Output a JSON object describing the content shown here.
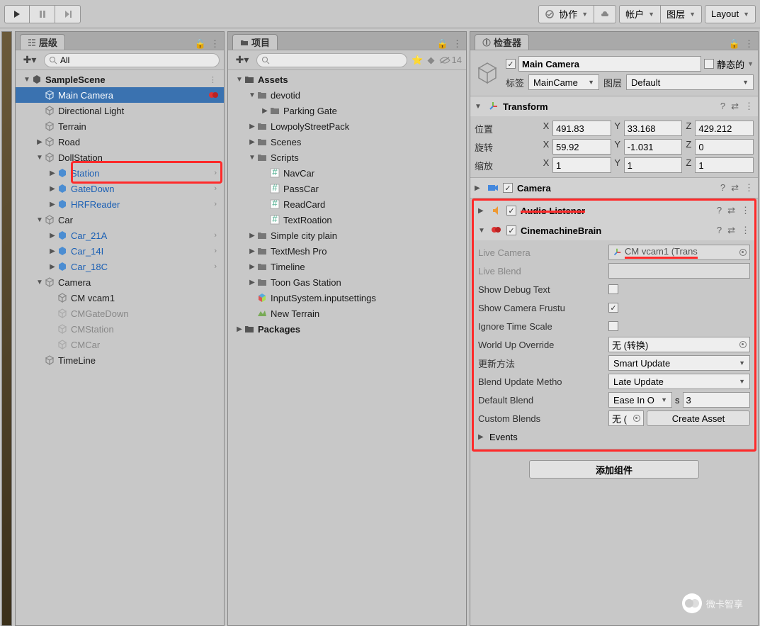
{
  "toolbar": {
    "collab": "协作",
    "account": "帐户",
    "layers": "图层",
    "layout": "Layout"
  },
  "hierarchy": {
    "title": "层级",
    "search_value": "All",
    "scene": "SampleScene",
    "items": {
      "main_camera": "Main Camera",
      "directional_light": "Directional Light",
      "terrain": "Terrain",
      "road": "Road",
      "doll_station": "DollStation",
      "station": "Station",
      "gate_down": "GateDown",
      "hrf_reader": "HRFReader",
      "car": "Car",
      "car21a": "Car_21A",
      "car14i": "Car_14I",
      "car18c": "Car_18C",
      "camera": "Camera",
      "cm_vcam1": "CM vcam1",
      "cm_gate_down": "CMGateDown",
      "cm_station": "CMStation",
      "cm_car": "CMCar",
      "timeline": "TimeLine"
    }
  },
  "project": {
    "title": "项目",
    "hidden_count": "14",
    "assets": "Assets",
    "devotid": "devotid",
    "parking_gate": "Parking Gate",
    "lowpoly": "LowpolyStreetPack",
    "scenes": "Scenes",
    "scripts": "Scripts",
    "navcar": "NavCar",
    "passcar": "PassCar",
    "readcard": "ReadCard",
    "textrotation": "TextRoation",
    "simple_city": "Simple city plain",
    "textmesh": "TextMesh Pro",
    "timeline": "Timeline",
    "toon_gas": "Toon Gas Station",
    "inputsystem": "InputSystem.inputsettings",
    "newterrain": "New Terrain",
    "packages": "Packages"
  },
  "inspector": {
    "title": "检查器",
    "name": "Main Camera",
    "static": "静态的",
    "tag_label": "标签",
    "tag_value": "MainCame",
    "layer_label": "图层",
    "layer_value": "Default",
    "transform": {
      "name": "Transform",
      "pos_label": "位置",
      "rot_label": "旋转",
      "scale_label": "缩放",
      "px": "491.83",
      "py": "33.168",
      "pz": "429.212",
      "rx": "59.92",
      "ry": "-1.031",
      "rz": "0",
      "sx": "1",
      "sy": "1",
      "sz": "1"
    },
    "camera_comp": "Camera",
    "audio_comp": "Audio Listener",
    "brain": {
      "name": "CinemachineBrain",
      "live_camera_label": "Live Camera",
      "live_camera_value": "CM vcam1 (Trans",
      "live_blend_label": "Live Blend",
      "show_debug_label": "Show Debug Text",
      "show_frustum_label": "Show Camera Frustu",
      "ignore_ts_label": "Ignore Time Scale",
      "world_up_label": "World Up Override",
      "world_up_value": "无 (转换)",
      "update_method_label": "更新方法",
      "update_method_value": "Smart Update",
      "blend_update_label": "Blend Update Metho",
      "blend_update_value": "Late Update",
      "default_blend_label": "Default Blend",
      "default_blend_value": "Ease In O",
      "default_blend_s": "s",
      "default_blend_dur": "3",
      "custom_blends_label": "Custom Blends",
      "custom_blends_value": "无 (",
      "create_asset": "Create Asset",
      "events": "Events"
    },
    "add_component": "添加组件"
  },
  "watermark": "微卡智享"
}
